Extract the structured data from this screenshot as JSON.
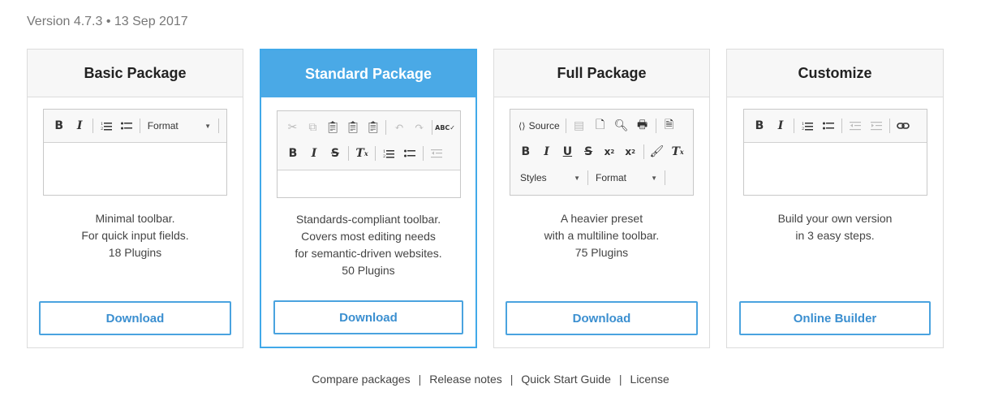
{
  "version": "Version 4.7.3 • 13 Sep 2017",
  "colors": {
    "accent": "#4aa9e6",
    "button_text": "#3b8fd0",
    "border": "#dcdcdc"
  },
  "cards": [
    {
      "title": "Basic Package",
      "format_label": "Format",
      "desc": [
        "Minimal toolbar.",
        "For quick input fields.",
        "18 Plugins"
      ],
      "button": "Download"
    },
    {
      "title": "Standard Package",
      "desc": [
        "Standards-compliant toolbar.",
        "Covers most editing needs",
        "for semantic-driven websites.",
        "50 Plugins"
      ],
      "button": "Download"
    },
    {
      "title": "Full Package",
      "source_label": "Source",
      "styles_label": "Styles",
      "format_label": "Format",
      "desc": [
        "A heavier preset",
        "with a multiline toolbar.",
        "75 Plugins"
      ],
      "button": "Download"
    },
    {
      "title": "Customize",
      "desc": [
        "Build your own version",
        "in 3 easy steps."
      ],
      "button": "Online Builder"
    }
  ],
  "footer": {
    "links": [
      "Compare packages",
      "Release notes",
      "Quick Start Guide",
      "License"
    ],
    "separator": "|"
  }
}
